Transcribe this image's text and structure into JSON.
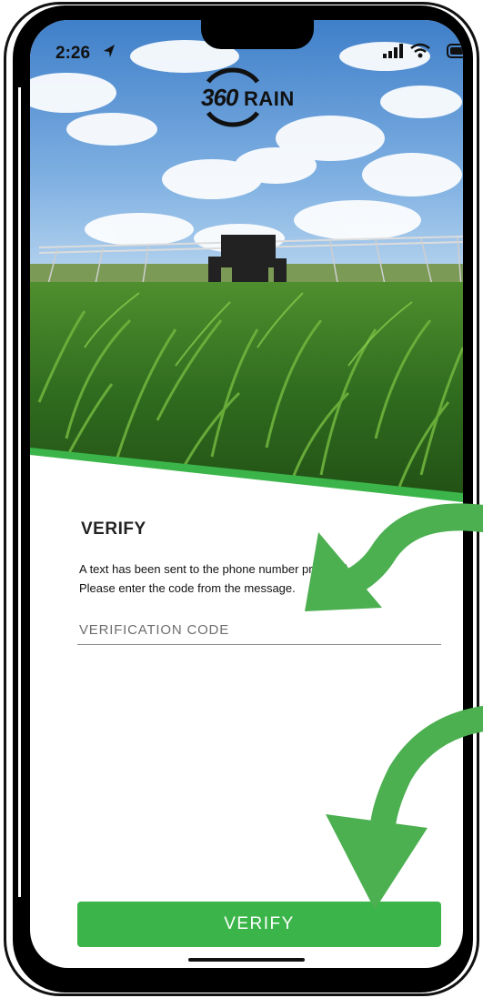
{
  "status_bar": {
    "time": "2:26",
    "location_icon": "location-arrow-icon",
    "signal_icon": "cellular-signal-icon",
    "wifi_icon": "wifi-icon",
    "battery_icon": "battery-icon"
  },
  "logo": {
    "number": "360",
    "word": "RAIN"
  },
  "verify": {
    "heading": "VERIFY",
    "desc_line1": "A text has been sent to the phone number provided.",
    "desc_line2": "Please enter the code from the message.",
    "code_placeholder": "VERIFICATION CODE",
    "code_value": "",
    "button_label": "VERIFY"
  },
  "colors": {
    "accent_green": "#3bb54a",
    "annotation_arrow_green": "#4caf50"
  }
}
